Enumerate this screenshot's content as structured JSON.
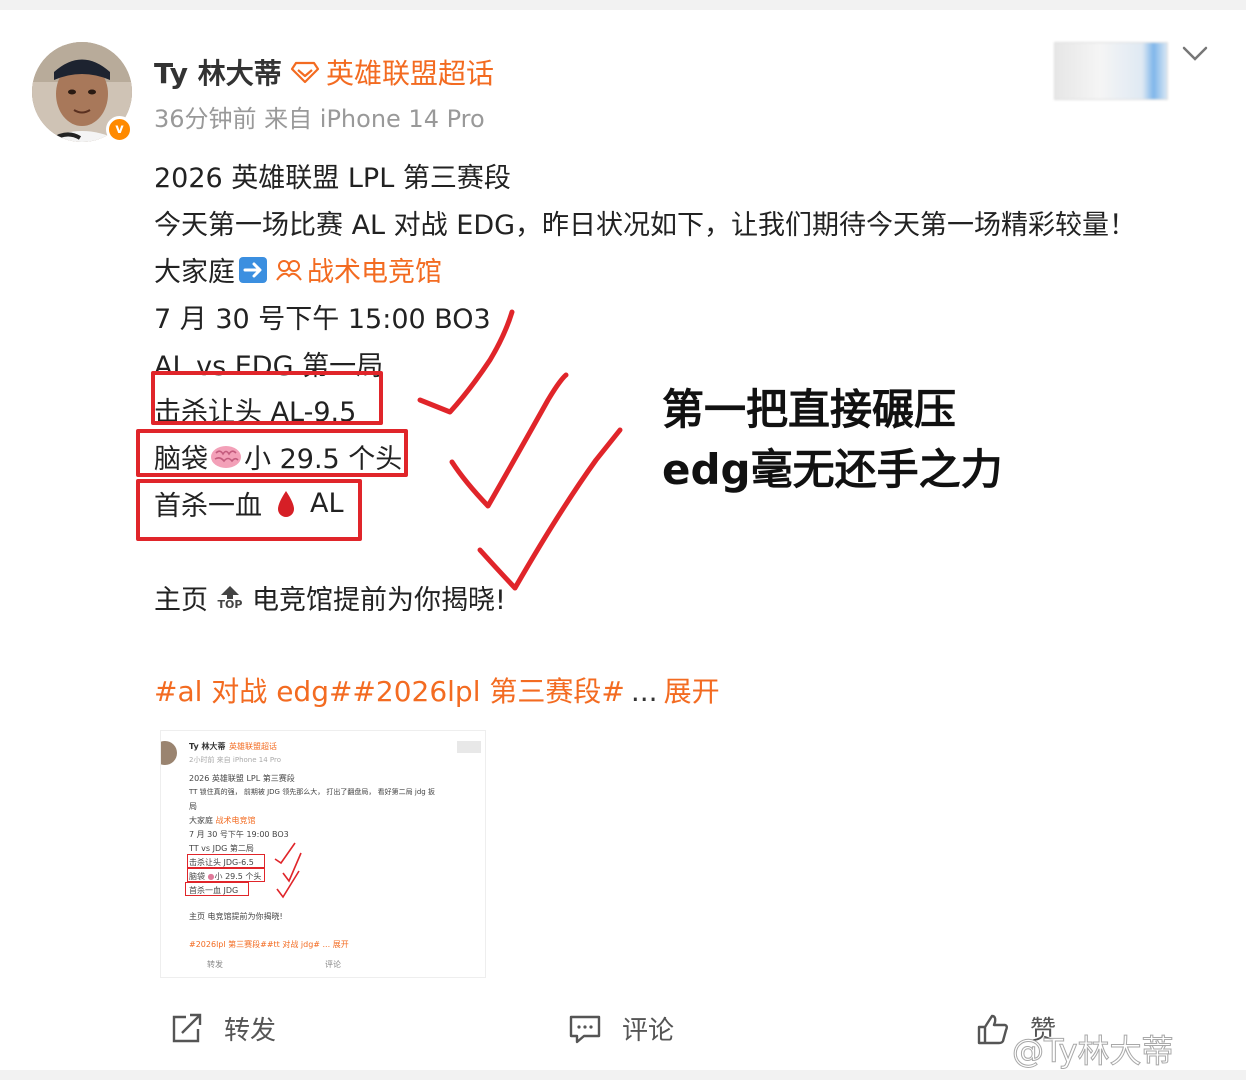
{
  "post": {
    "username": "Ty 林大蒂",
    "topic_label": "英雄联盟超话",
    "meta": "36分钟前  来自 iPhone 14 Pro",
    "verified_badge": "v",
    "lines": {
      "l1": "2026 英雄联盟 LPL 第三赛段",
      "l2": "今天第一场比赛 AL 对战 EDG，昨日状况如下，让我们期待今天第一场精彩较量！",
      "l3_prefix": "大家庭",
      "l3_link": "战术电竞馆",
      "l4": "7 月 30 号下午 15:00 BO3",
      "l5": "AL vs EDG 第一局",
      "l6": "击杀让头 AL-9.5",
      "l7_prefix": "脑袋",
      "l7_suffix": "小 29.5 个头",
      "l8_prefix": "首杀一血",
      "l8_suffix": "AL",
      "l9_prefix": "主页",
      "l9_top": "TOP",
      "l9_suffix": "电竞馆提前为你揭晓!"
    },
    "hashtags": "#al 对战 edg##2026lpl 第三赛段#",
    "more_dots": "...",
    "expand": "展开"
  },
  "annotation": {
    "line1": "第一把直接碾压",
    "line2": "edg毫无还手之力"
  },
  "thumbnail": {
    "username": "Ty 林大蒂",
    "topic": "英雄联盟超话",
    "meta": "2小时前  来自 iPhone 14 Pro",
    "l1": "2026 英雄联盟 LPL 第三赛段",
    "l2": "TT 锁住真的强，  前期被 JDG 领先那么大，  打出了翻盘局，  看好第二局 jdg 扳",
    "l2b": "局",
    "l3": "大家庭",
    "l3_link": "战术电竞馆",
    "l4": "7 月 30 号下午 19:00 BO3",
    "l5": "TT vs JDG 第二局",
    "l6": "击杀让头 JDG-6.5",
    "l7": "脑袋",
    "l7b": "小 29.5 个头",
    "l8": "首杀一血 JDG",
    "l9": "主页  电竞馆提前为你揭晓!",
    "hashtags": "#2026lpl 第三赛段##tt 对战 jdg#  ... 展开",
    "repost": "转发",
    "comment": "评论"
  },
  "actions": {
    "repost": "转发",
    "comment": "评论",
    "like": "赞"
  },
  "watermark": "@Ty林大蒂",
  "colors": {
    "accent": "#f36b21",
    "annotation_red": "#e0252a",
    "verified": "#ff8a00"
  }
}
